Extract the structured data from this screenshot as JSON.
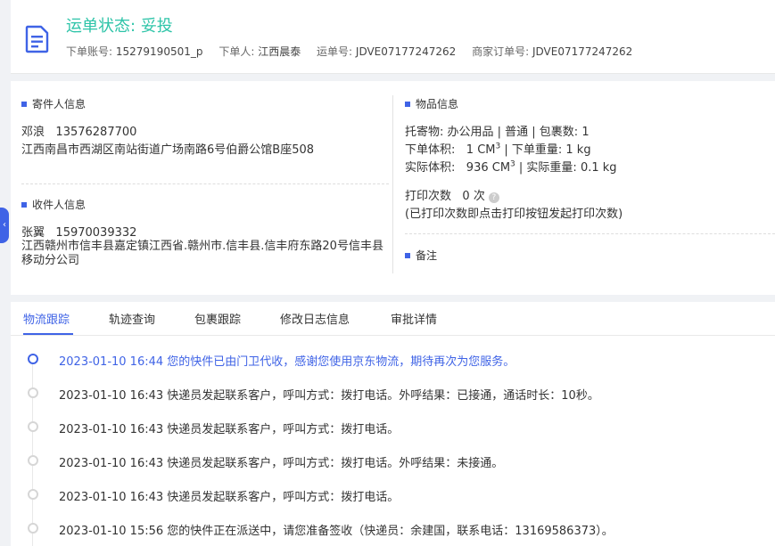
{
  "header": {
    "status_label": "运单状态:",
    "status_value": "妥投",
    "meta": [
      {
        "label": "下单账号:",
        "value": "15279190501_p"
      },
      {
        "label": "下单人:",
        "value": "江西晨泰"
      },
      {
        "label": "运单号:",
        "value": "JDVE07177247262"
      },
      {
        "label": "商家订单号:",
        "value": "JDVE07177247262"
      }
    ]
  },
  "sender": {
    "title": "寄件人信息",
    "name": "邓浪",
    "phone": "13576287700",
    "address": "江西南昌市西湖区南站街道广场南路6号伯爵公馆B座508"
  },
  "receiver": {
    "title": "收件人信息",
    "name": "张翼",
    "phone": "15970039332",
    "address": "江西赣州市信丰县嘉定镇江西省.赣州市.信丰县.信丰府东路20号信丰县移动分公司"
  },
  "goods": {
    "title": "物品信息",
    "line1": "托寄物:  办公用品 | 普通 | 包裹数:  1",
    "order_volume_label": "下单体积:",
    "order_volume_value": "1 CM",
    "order_weight": "| 下单重量:  1 kg",
    "actual_volume_label": "实际体积:",
    "actual_volume_value": "936 CM",
    "actual_weight": "| 实际重量:  0.1 kg",
    "volume_exp": "3",
    "print_label": "打印次数",
    "print_count": "0 次",
    "print_note": "(已打印次数即点击打印按钮发起打印次数)",
    "help_glyph": "?"
  },
  "remarks": {
    "title": "备注"
  },
  "tabs": [
    {
      "label": "物流跟踪"
    },
    {
      "label": "轨迹查询"
    },
    {
      "label": "包裹跟踪"
    },
    {
      "label": "修改日志信息"
    },
    {
      "label": "审批详情"
    }
  ],
  "timeline": [
    {
      "text": "2023-01-10 16:44 您的快件已由门卫代收，感谢您使用京东物流，期待再次为您服务。"
    },
    {
      "text": "2023-01-10 16:43 快递员发起联系客户，呼叫方式：拨打电话。外呼结果：已接通，通话时长：10秒。"
    },
    {
      "text": "2023-01-10 16:43 快递员发起联系客户，呼叫方式：拨打电话。"
    },
    {
      "text": "2023-01-10 16:43 快递员发起联系客户，呼叫方式：拨打电话。外呼结果：未接通。"
    },
    {
      "text": "2023-01-10 16:43 快递员发起联系客户，呼叫方式：拨打电话。"
    },
    {
      "text": "2023-01-10 15:56 您的快件正在派送中，请您准备签收（快递员：余建国，联系电话：13169586373）。"
    }
  ],
  "side_toggle_glyph": "‹",
  "colors": {
    "accent": "#3f63e6",
    "status": "#2dc4a8"
  },
  "icons": {
    "document": "document-icon",
    "help": "question-icon"
  }
}
